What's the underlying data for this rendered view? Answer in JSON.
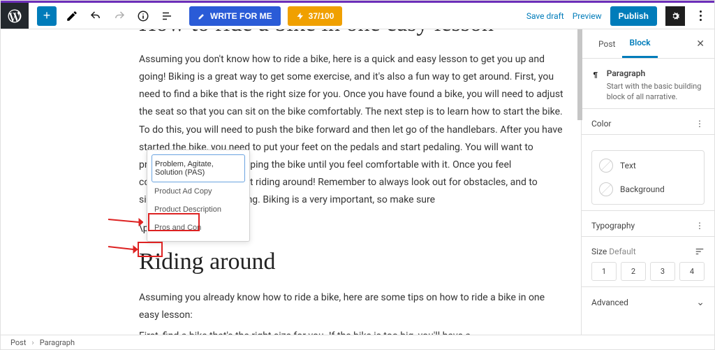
{
  "toolbar": {
    "write_label": "WRITE FOR ME",
    "credits_label": "37/100"
  },
  "top_actions": {
    "save_draft": "Save draft",
    "preview": "Preview",
    "publish": "Publish"
  },
  "editor": {
    "heading1": "How to ride a bike in one easy lesson",
    "para1": "Assuming you don't know how to ride a bike, here is a quick and easy lesson to get you up and going! Biking is a great way to get some exercise, and it's also a fun way to get around. First, you need to find a bike that is the right size for you. Once you have found a bike, you will need to adjust the seat so that you can sit on the bike comfortably. The next step is to learn how to start the bike. To do this, you will need to push the bike forward and then let go of the handlebars. After you have started the bike, you need to put your feet on the pedals and start pedaling. You will want to practice starting and stopping the bike until you feel comfortable with it. Once you feel comfortable, you can start riding around! Remember to always look out for obstacles, and to signal when you are turning. Biking is a very important, so make sure",
    "slash_cmd": "\\pro",
    "heading2": "Riding around",
    "para2": "Assuming you already know how to ride a bike, here are some tips on how to ride a bike in one easy lesson:",
    "para3": "First, find a bike that's the right size for you. If the bike is too big, you'll have a",
    "dropdown": {
      "opt1": "Problem, Agitate, Solution (PAS)",
      "opt2": "Product Ad Copy",
      "opt3": "Product Description",
      "opt4": "Pros and Con"
    }
  },
  "sidebar": {
    "tabs": {
      "post": "Post",
      "block": "Block"
    },
    "paragraph": {
      "title": "Paragraph",
      "desc": "Start with the basic building block of all narrative."
    },
    "sections": {
      "color": "Color",
      "text": "Text",
      "background": "Background",
      "typography": "Typography",
      "size_label": "Size",
      "size_default": "Default",
      "sizes": [
        "1",
        "2",
        "3",
        "4"
      ],
      "advanced": "Advanced"
    }
  },
  "breadcrumb": {
    "root": "Post",
    "current": "Paragraph"
  }
}
